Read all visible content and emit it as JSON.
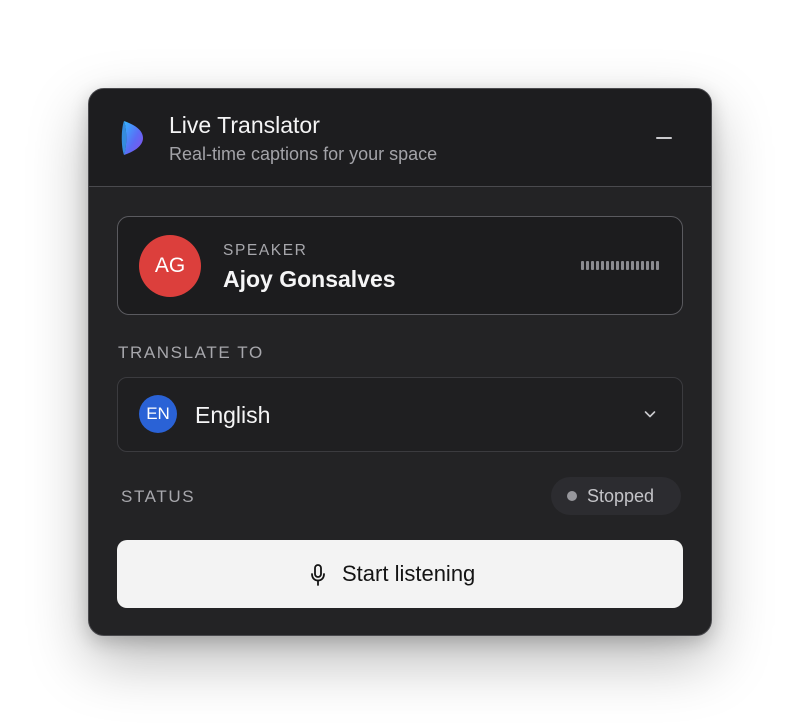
{
  "header": {
    "title": "Live Translator",
    "subtitle": "Real-time captions for your space",
    "logo_icon": "app-logo-icon",
    "minimize_icon": "minimize-icon"
  },
  "speaker": {
    "label": "SPEAKER",
    "initials": "AG",
    "name": "Ajoy Gonsalves",
    "avatar_color": "#dc3f3c",
    "audio_meter_icon": "audio-level-meter"
  },
  "translate": {
    "label": "TRANSLATE TO",
    "selected_code": "EN",
    "selected_language": "English",
    "badge_color": "#2a62d6",
    "dropdown_icon": "chevron-down-icon"
  },
  "status": {
    "label": "STATUS",
    "value": "Stopped",
    "dot_color": "#97979c"
  },
  "action": {
    "start_label": "Start listening",
    "icon": "microphone-icon"
  },
  "colors": {
    "panel_bg": "#232325",
    "header_bg": "#1d1d1f",
    "button_bg": "#f3f3f3"
  }
}
